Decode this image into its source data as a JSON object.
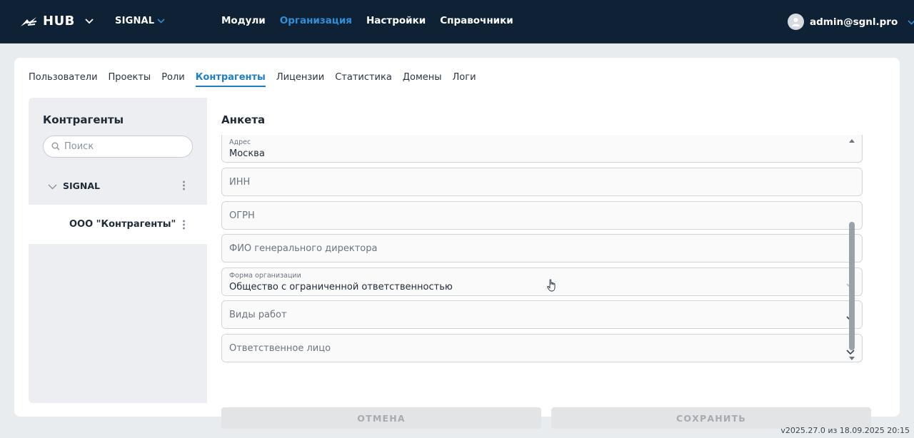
{
  "header": {
    "logo_text": "HUB",
    "workspace": "SIGNAL",
    "nav": [
      {
        "label": "Модули",
        "active": false
      },
      {
        "label": "Организация",
        "active": true
      },
      {
        "label": "Настройки",
        "active": false
      },
      {
        "label": "Справочники",
        "active": false
      }
    ],
    "user_email": "admin@sgnl.pro"
  },
  "tabs": [
    {
      "label": "Пользователи",
      "active": false
    },
    {
      "label": "Проекты",
      "active": false
    },
    {
      "label": "Роли",
      "active": false
    },
    {
      "label": "Контрагенты",
      "active": true
    },
    {
      "label": "Лицензии",
      "active": false
    },
    {
      "label": "Статистика",
      "active": false
    },
    {
      "label": "Домены",
      "active": false
    },
    {
      "label": "Логи",
      "active": false
    }
  ],
  "left_panel": {
    "title": "Контрагенты",
    "search_placeholder": "Поиск",
    "tree": {
      "root_label": "SIGNAL",
      "child_label": "ООО \"Контрагенты\""
    }
  },
  "form": {
    "title": "Анкета",
    "fields": {
      "address": {
        "label": "Адрес",
        "value": "Москва"
      },
      "inn": {
        "placeholder": "ИНН"
      },
      "ogrn": {
        "placeholder": "ОГРН"
      },
      "director": {
        "placeholder": "ФИО генерального директора"
      },
      "org_form": {
        "label": "Форма организации",
        "value": "Общество с ограниченной ответственностью"
      },
      "work_types": {
        "placeholder": "Виды работ"
      },
      "responsible": {
        "placeholder": "Ответственное лицо"
      }
    },
    "cancel_label": "ОТМЕНА",
    "save_label": "СОХРАНИТЬ"
  },
  "footer": {
    "version": "v2025.27.0 из 18.09.2025 20:15"
  },
  "colors": {
    "topbar": "#0f2235",
    "accent": "#1d7fc8",
    "nav_active": "#2f8fd8"
  }
}
